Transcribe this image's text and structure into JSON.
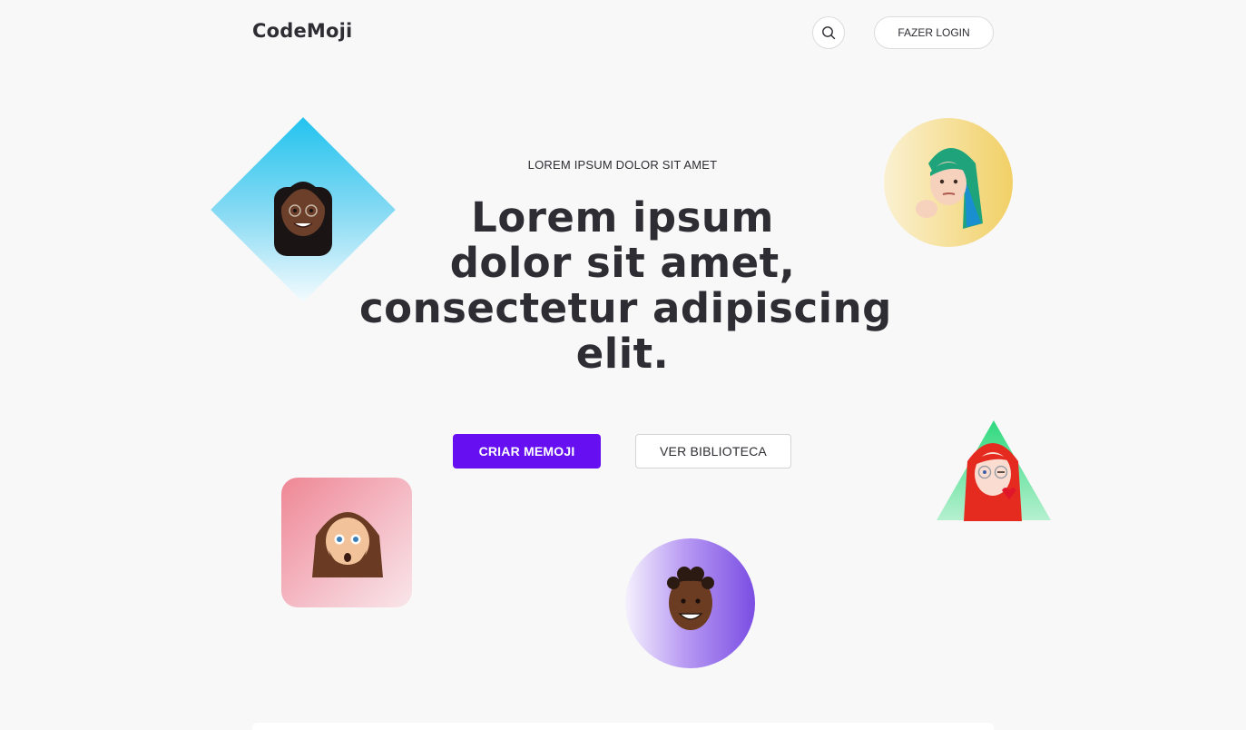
{
  "header": {
    "logo": "CodeMoji",
    "login_label": "FAZER LOGIN"
  },
  "hero": {
    "eyebrow": "LOREM IPSUM DOLOR SIT AMET",
    "headline_lines": [
      "Lorem ipsum",
      "dolor sit amet,",
      "consectetur adipiscing",
      "elit."
    ],
    "primary_cta": "CRIAR MEMOJI",
    "secondary_cta": "VER BIBLIOTECA"
  },
  "icons": {
    "search": "search-icon"
  },
  "colors": {
    "background": "#f8f8f8",
    "text": "#2d2d33",
    "primary": "#6610f2",
    "diamond": "#22c3ee",
    "circle_yellow": "#f1d066",
    "triangle": "#5fe3a1",
    "square_pink": "#ef8795",
    "circle_purple": "#7a4ee3"
  }
}
